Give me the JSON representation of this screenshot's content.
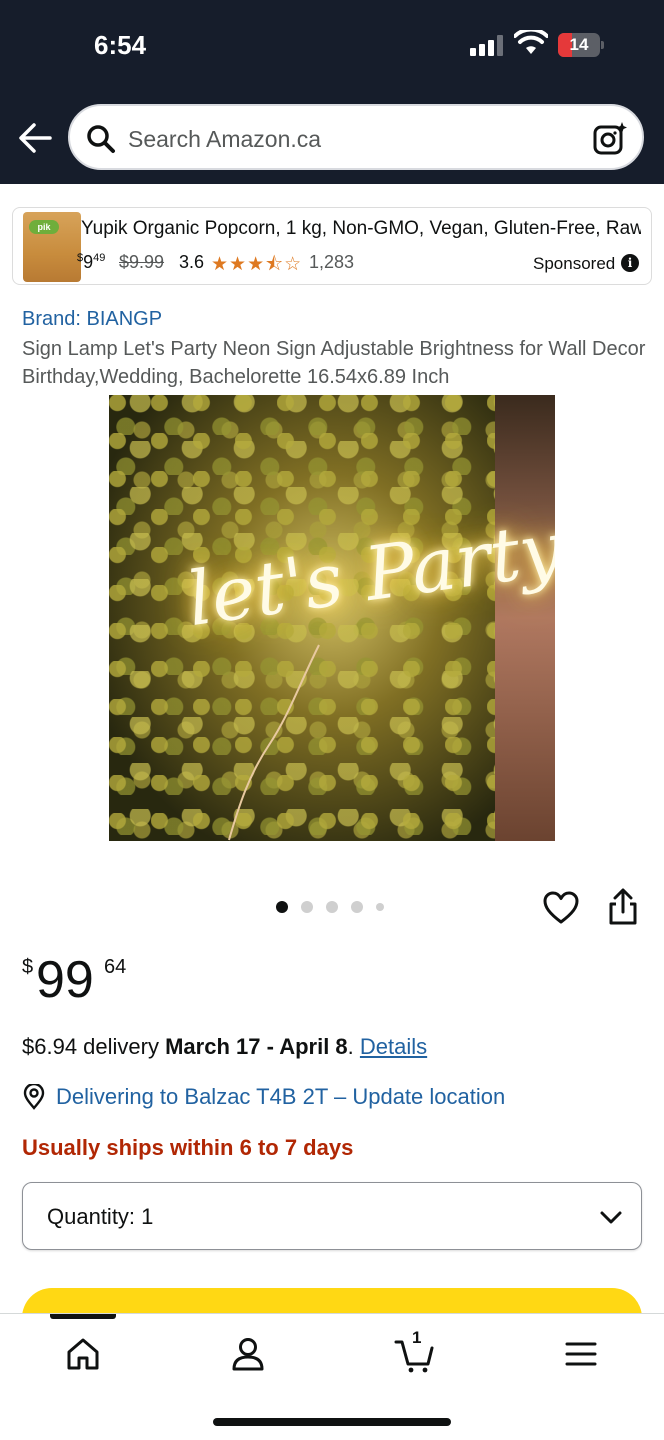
{
  "status_bar": {
    "time": "6:54",
    "battery": "14"
  },
  "header": {
    "search_placeholder": "Search Amazon.ca"
  },
  "sponsored_ad": {
    "title": "Yupik Organic Popcorn, 1 kg, Non-GMO, Vegan, Gluten-Free, Raw,...",
    "price_symbol": "$",
    "price_whole": "9",
    "price_fraction": "49",
    "list_price": "$9.99",
    "rating": "3.6",
    "stars": "★★★⯪☆",
    "review_count": "1,283",
    "label": "Sponsored",
    "thumb_label": "pik"
  },
  "product": {
    "brand": "Brand: BIANGP",
    "title": "Sign Lamp Let's Party Neon Sign Adjustable Brightness for Wall Decor Birthday,Wedding, Bachelorette 16.54x6.89 Inch",
    "image_text": "let's Party",
    "image_count": 5,
    "image_index": 1,
    "price_symbol": "$",
    "price_whole": "99",
    "price_fraction": "64"
  },
  "delivery": {
    "prefix": "$6.94 delivery ",
    "dates": "March 17 - April 8",
    "suffix": ". ",
    "details_link": "Details",
    "location": "Delivering to Balzac T4B 2T – Update location",
    "ships": "Usually ships within 6 to 7 days"
  },
  "quantity": {
    "label": "Quantity:  1"
  },
  "tabbar": {
    "cart_count": "1"
  },
  "colors": {
    "header_bg": "#161d2b",
    "link": "#2162a1",
    "alert": "#b12704",
    "star": "#de7921",
    "button_yellow": "#ffd814"
  }
}
